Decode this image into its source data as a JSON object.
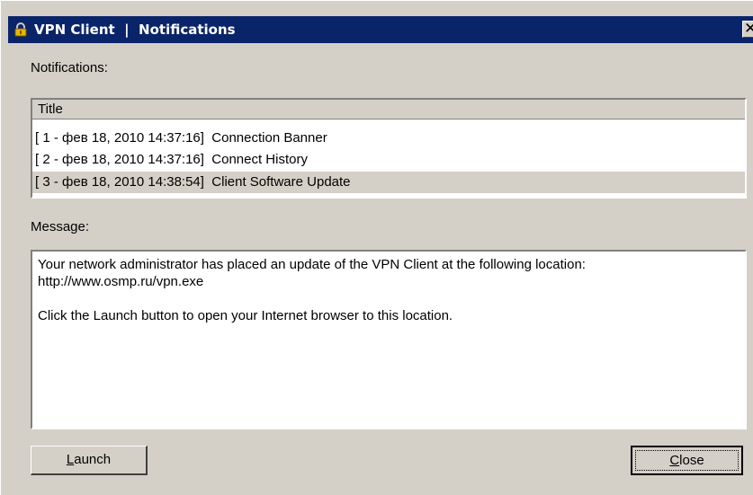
{
  "window": {
    "title": "VPN Client  |  Notifications",
    "close_glyph": "✕"
  },
  "notifications": {
    "label": "Notifications:",
    "column_title": "Title",
    "items": [
      {
        "text": "[ 1 - фев 18, 2010 14:37:16]  Connection Banner",
        "selected": false
      },
      {
        "text": "[ 2 - фев 18, 2010 14:37:16]  Connect History",
        "selected": false
      },
      {
        "text": "[ 3 - фев 18, 2010 14:38:54]  Client Software Update",
        "selected": true
      }
    ]
  },
  "message": {
    "label": "Message:",
    "text": "Your network administrator has placed an update of the VPN Client at the following location:\nhttp://www.osmp.ru/vpn.exe\n\nClick the Launch button to open your Internet browser to this location."
  },
  "buttons": {
    "launch_mnemonic": "L",
    "launch_rest": "aunch",
    "close_mnemonic": "C",
    "close_rest": "lose"
  },
  "icons": {
    "title_icon": "padlock-icon"
  }
}
